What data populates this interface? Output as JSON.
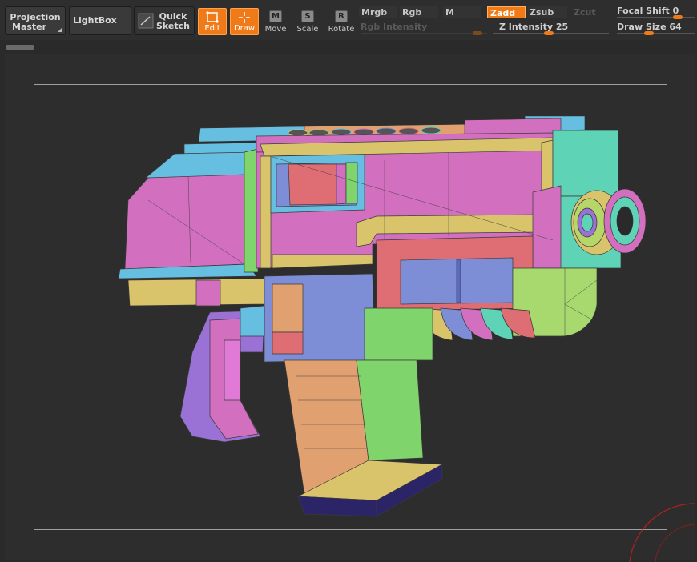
{
  "toolbar": {
    "projection_master": [
      "Projection",
      "Master"
    ],
    "lightbox": "LightBox",
    "quick_sketch": [
      "Quick",
      "Sketch"
    ],
    "tools": [
      {
        "label": "Edit",
        "key": "",
        "active": true
      },
      {
        "label": "Draw",
        "key": "",
        "active": true
      },
      {
        "label": "Move",
        "key": "M",
        "active": false
      },
      {
        "label": "Scale",
        "key": "S",
        "active": false
      },
      {
        "label": "Rotate",
        "key": "R",
        "active": false
      }
    ],
    "modes": {
      "mrgb": "Mrgb",
      "rgb": "Rgb",
      "m": "M",
      "zadd": "Zadd",
      "zsub": "Zsub",
      "zcut": "Zcut"
    },
    "sliders": {
      "rgb_intensity": {
        "label": "Rgb Intensity",
        "value": ""
      },
      "z_intensity": {
        "label": "Z Intensity",
        "value": "25"
      },
      "focal_shift": {
        "label": "Focal Shift",
        "value": "0"
      },
      "draw_size": {
        "label": "Draw Size",
        "value": "64"
      }
    }
  },
  "colors": {
    "accent": "#f07a18",
    "pink": "#d36fbf",
    "cyan": "#66bfe0",
    "yellow": "#d9c46c",
    "green": "#7fd46b",
    "orange": "#e0a070",
    "blue": "#7d8ed6",
    "teal": "#5fd3b6",
    "red": "#df6d74",
    "purple": "#9a72d6",
    "navy": "#2b2466"
  }
}
